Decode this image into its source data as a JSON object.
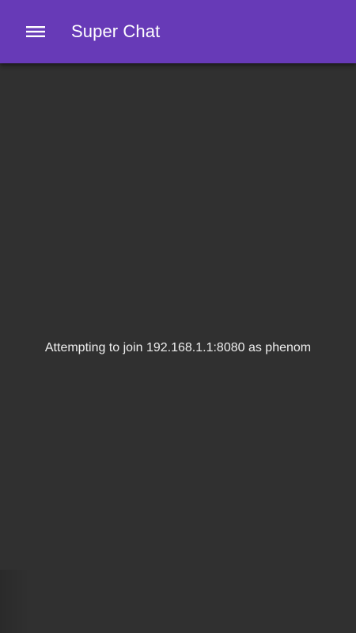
{
  "app_bar": {
    "title": "Super Chat",
    "menu_icon": "menu-icon",
    "color": "#673ab7"
  },
  "main": {
    "status_message": "Attempting to join 192.168.1.1:8080 as phenom",
    "background": "#303030"
  }
}
